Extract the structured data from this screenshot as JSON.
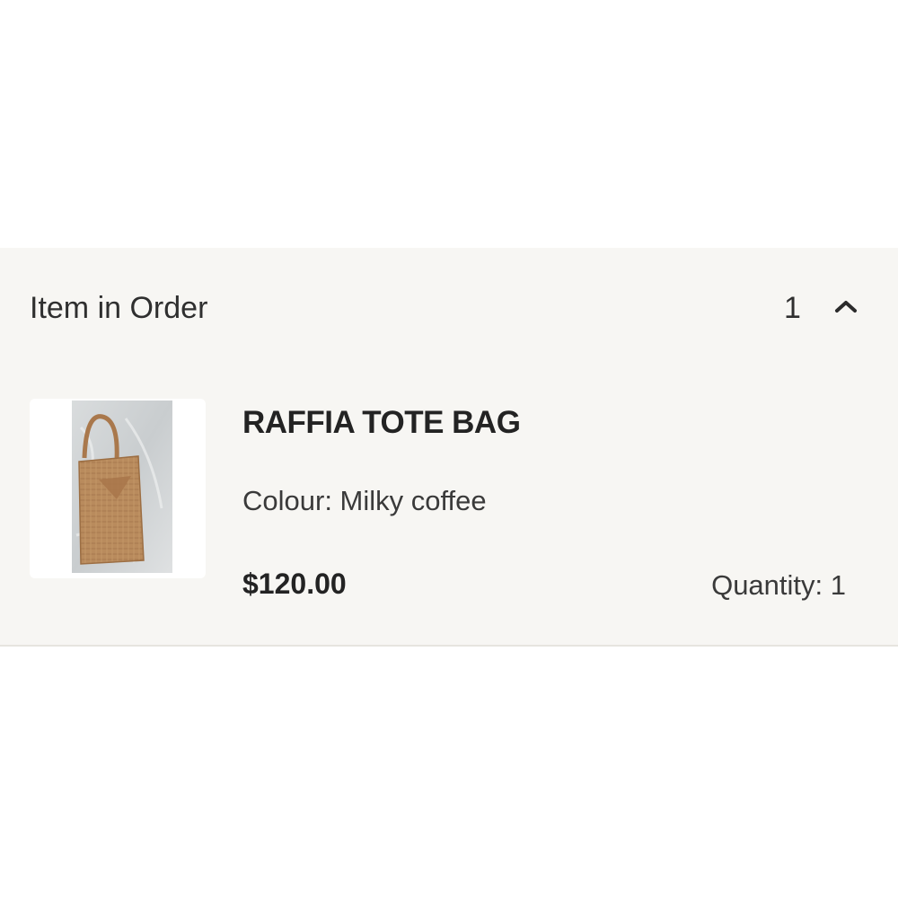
{
  "order_section": {
    "title": "Item in Order",
    "item_count": "1",
    "toggle_icon": "chevron-up-icon"
  },
  "item": {
    "name": "RAFFIA TOTE BAG",
    "colour": "Colour: Milky coffee",
    "price": "$120.00",
    "quantity": "Quantity: 1",
    "thumbnail": "raffia-tote-bag-photo"
  },
  "colors": {
    "panel_background": "#f7f6f3",
    "text_primary": "#232323",
    "bag_tan": "#b88a5c"
  }
}
